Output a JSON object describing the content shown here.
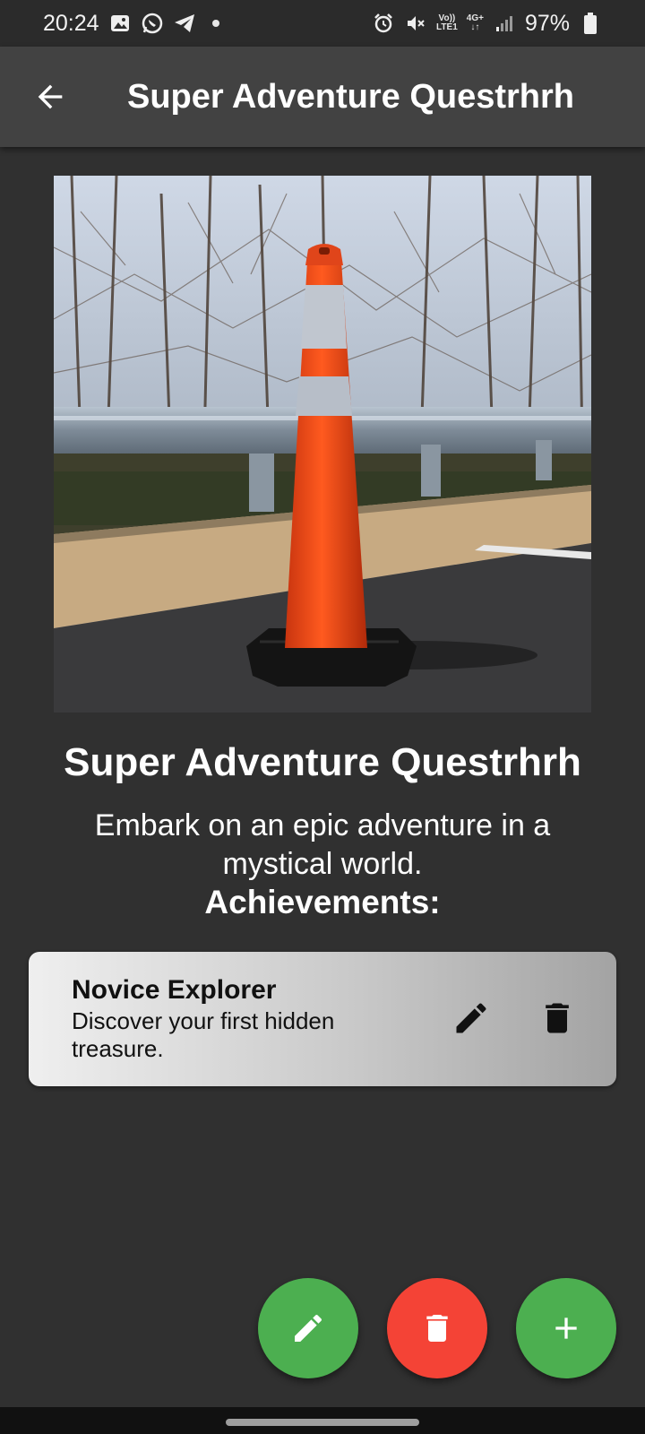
{
  "status_bar": {
    "time": "20:24",
    "network_top": "Vo))",
    "network_bottom": "LTE1",
    "network_gen": "4G+",
    "battery_percent": "97%",
    "icons": [
      "image-icon",
      "whatsapp-icon",
      "telegram-icon",
      "notification-dot",
      "alarm-icon",
      "mute-icon",
      "signal-icon",
      "battery-icon"
    ]
  },
  "app_bar": {
    "title": "Super Adventure Questrhrh",
    "back_icon": "arrow-back-icon"
  },
  "quest": {
    "image_description": "orange-traffic-cone-photo",
    "title": "Super Adventure Questrhrh",
    "description": "Embark on an epic adventure in a mystical world.",
    "achievements_heading": "Achievements:"
  },
  "achievements": [
    {
      "name": "Novice Explorer",
      "description": "Discover your first hidden treasure."
    }
  ],
  "fabs": {
    "edit": {
      "icon": "pencil-icon",
      "color": "#4caf50"
    },
    "delete": {
      "icon": "trash-icon",
      "color": "#f44336"
    },
    "add": {
      "icon": "plus-icon",
      "color": "#4caf50"
    }
  },
  "colors": {
    "background": "#303030",
    "app_bar": "#424242",
    "green": "#4caf50",
    "red": "#f44336"
  }
}
